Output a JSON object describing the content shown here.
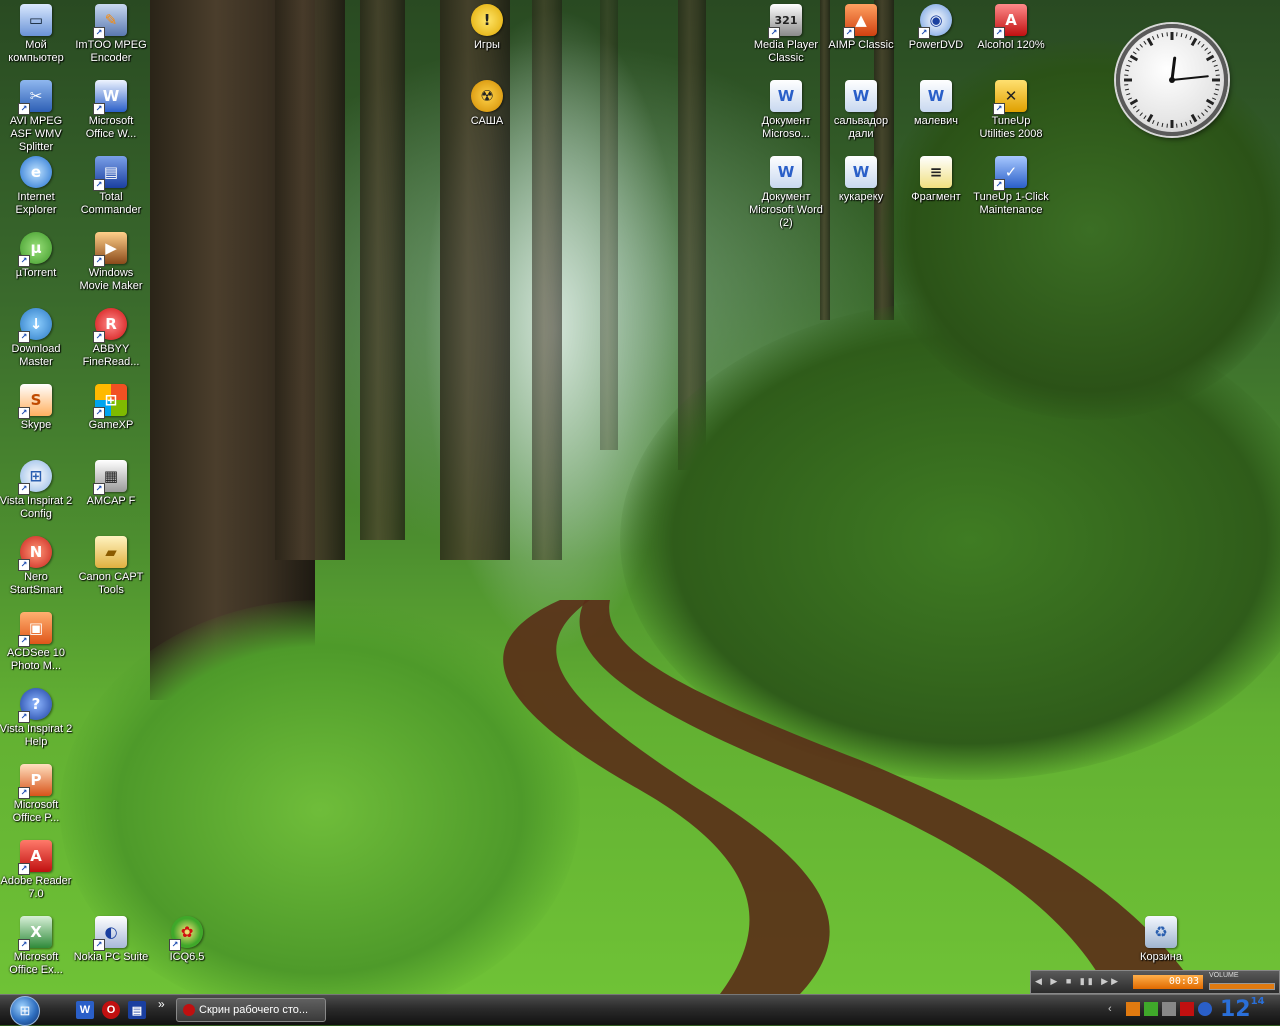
{
  "desktop": {
    "left_column": [
      {
        "label": "Мой компьютер",
        "icon": "computer-icon"
      },
      {
        "label": "AVI MPEG ASF WMV Splitter",
        "icon": "splitter-icon"
      },
      {
        "label": "Internet Explorer",
        "icon": "internet-explorer-icon"
      },
      {
        "label": "µTorrent",
        "icon": "utorrent-icon"
      },
      {
        "label": "Download Master",
        "icon": "download-master-icon"
      },
      {
        "label": "Skype",
        "icon": "skype-icon"
      },
      {
        "label": "Vista Inspirat 2 Config",
        "icon": "vista-inspirat-icon"
      },
      {
        "label": "Nero StartSmart",
        "icon": "nero-icon"
      },
      {
        "label": "ACDSee 10 Photo M...",
        "icon": "acdsee-icon"
      },
      {
        "label": "Vista Inspirat 2 Help",
        "icon": "help-icon"
      },
      {
        "label": "Microsoft Office P...",
        "icon": "powerpoint-icon"
      },
      {
        "label": "Adobe Reader 7.0",
        "icon": "adobe-reader-icon"
      },
      {
        "label": "Microsoft Office Ex...",
        "icon": "excel-icon"
      }
    ],
    "second_column": [
      {
        "label": "ImTOO MPEG Encoder",
        "icon": "imtoo-icon"
      },
      {
        "label": "Microsoft Office W...",
        "icon": "word-icon"
      },
      {
        "label": "Total Commander",
        "icon": "floppy-icon"
      },
      {
        "label": "Windows Movie Maker",
        "icon": "movie-maker-icon"
      },
      {
        "label": "ABBYY FineRead...",
        "icon": "abbyy-icon"
      },
      {
        "label": "GameXP",
        "icon": "windows-flag-icon"
      },
      {
        "label": "AMCAP F",
        "icon": "amcap-icon"
      },
      {
        "label": "Canon CAPT Tools",
        "icon": "folder-icon"
      },
      {
        "label": "Nokia PC Suite",
        "icon": "nokia-icon"
      }
    ],
    "extra": [
      {
        "label": "ICQ6.5",
        "icon": "icq-icon"
      },
      {
        "label": "Игры",
        "icon": "warning-icon"
      },
      {
        "label": "САША",
        "icon": "radiation-icon"
      },
      {
        "label": "Корзина",
        "icon": "recycle-bin-icon"
      }
    ],
    "top_right": [
      {
        "label": "Media Player Classic",
        "icon": "media-player-icon"
      },
      {
        "label": "AIMP Classic",
        "icon": "aimp-icon"
      },
      {
        "label": "PowerDVD",
        "icon": "powerdvd-icon"
      },
      {
        "label": "Alcohol 120%",
        "icon": "alcohol-icon"
      },
      {
        "label": "Документ Microso...",
        "icon": "word-document-icon"
      },
      {
        "label": "сальвадор дали",
        "icon": "word-document-icon"
      },
      {
        "label": "малевич",
        "icon": "word-document-icon"
      },
      {
        "label": "TuneUp Utilities 2008",
        "icon": "tuneup-icon"
      },
      {
        "label": "Документ Microsoft Word (2)",
        "icon": "word-document-icon"
      },
      {
        "label": "кукареку",
        "icon": "word-document-icon"
      },
      {
        "label": "Фрагмент",
        "icon": "text-fragment-icon"
      },
      {
        "label": "TuneUp 1-Click Maintenance",
        "icon": "tuneup-maintenance-icon"
      }
    ]
  },
  "clock_widget": {
    "hour": 12,
    "minute": 14
  },
  "media_bar": {
    "time": "00:03",
    "volume_label": "VOLUME"
  },
  "taskbar": {
    "task_label": "Скрин рабочего сто...",
    "overflow_glyph": "»",
    "tray_clock": "12",
    "tray_clock_minutes": "14"
  },
  "colors": {
    "taskbar": "#2b2b2b",
    "accent": "#2f6fc0"
  }
}
